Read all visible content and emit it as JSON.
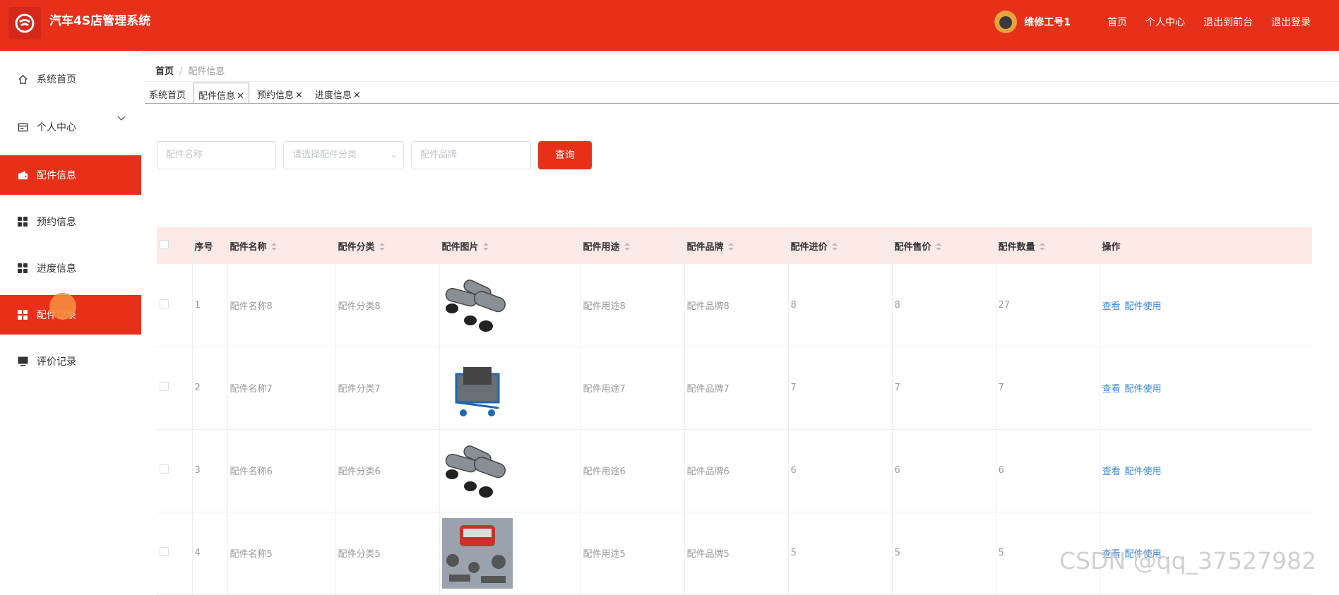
{
  "header": {
    "app_title": "汽车4S店管理系统",
    "username": "维修工号1",
    "nav": [
      "首页",
      "个人中心",
      "退出到前台",
      "退出登录"
    ]
  },
  "sidebar": {
    "items": [
      {
        "label": "系统首页",
        "icon": "home-icon"
      },
      {
        "label": "个人中心",
        "icon": "user-card-icon"
      },
      {
        "label": "配件信息",
        "icon": "wallet-icon"
      },
      {
        "label": "预约信息",
        "icon": "grid-icon"
      },
      {
        "label": "进度信息",
        "icon": "grid-icon"
      },
      {
        "label": "配件记录",
        "icon": "grid-icon"
      },
      {
        "label": "评价记录",
        "icon": "monitor-icon"
      }
    ]
  },
  "breadcrumb": {
    "home": "首页",
    "current": "配件信息"
  },
  "tabs": [
    "系统首页",
    "配件信息",
    "预约信息",
    "进度信息"
  ],
  "search": {
    "name_placeholder": "配件名称",
    "category_placeholder": "请选择配件分类",
    "brand_placeholder": "配件品牌",
    "button": "查询"
  },
  "table": {
    "headers": [
      "序号",
      "配件名称",
      "配件分类",
      "配件图片",
      "配件用途",
      "配件品牌",
      "配件进价",
      "配件售价",
      "配件数量",
      "操作"
    ],
    "rows": [
      {
        "no": "1",
        "name": "配件名称8",
        "category": "配件分类8",
        "image": "exhaust-pipes",
        "use": "配件用途8",
        "brand": "配件品牌8",
        "cost": "8",
        "price": "8",
        "qty": "27"
      },
      {
        "no": "2",
        "name": "配件名称7",
        "category": "配件分类7",
        "image": "parts-cart",
        "use": "配件用途7",
        "brand": "配件品牌7",
        "cost": "7",
        "price": "7",
        "qty": "7"
      },
      {
        "no": "3",
        "name": "配件名称6",
        "category": "配件分类6",
        "image": "exhaust-pipes",
        "use": "配件用途6",
        "brand": "配件品牌6",
        "cost": "6",
        "price": "6",
        "qty": "6"
      },
      {
        "no": "4",
        "name": "配件名称5",
        "category": "配件分类5",
        "image": "car-parts",
        "use": "配件用途5",
        "brand": "配件品牌5",
        "cost": "5",
        "price": "5",
        "qty": "5"
      }
    ],
    "actions": {
      "view": "查看",
      "use": "配件使用"
    }
  },
  "watermark": "CSDN @qq_37527982",
  "colors": {
    "accent": "#e6301a",
    "link": "#3a85d4",
    "header_row": "#fbe9e6"
  }
}
